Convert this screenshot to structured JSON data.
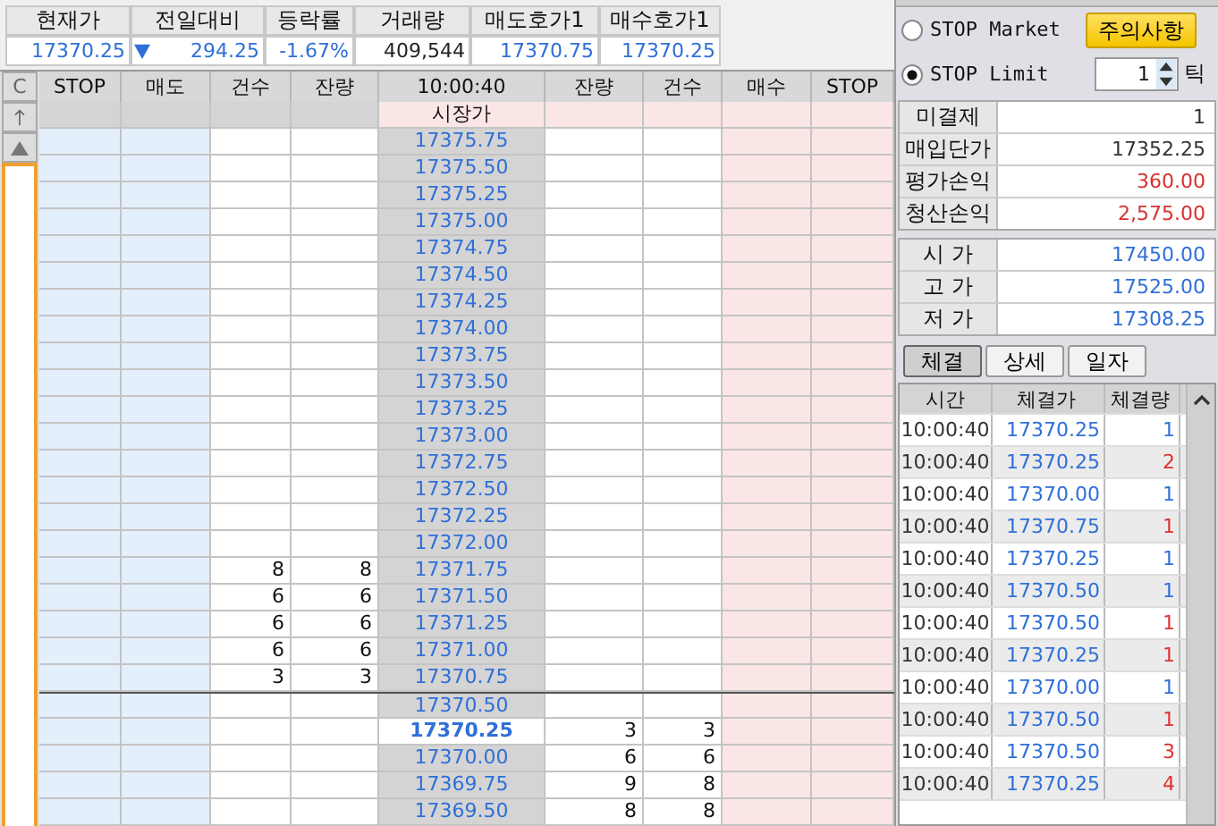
{
  "quote": {
    "columns": [
      "현재가",
      "전일대비",
      "등락률",
      "거래량",
      "매도호가1",
      "매수호가1"
    ],
    "values": [
      "17370.25",
      "294.25",
      "-1.67%",
      "409,544",
      "17370.75",
      "17370.25"
    ]
  },
  "ladder": {
    "clear_button": "C",
    "columns": [
      "STOP",
      "매도",
      "건수",
      "잔량",
      "10:00:40",
      "잔량",
      "건수",
      "매수",
      "STOP"
    ],
    "market_row": "시장가",
    "rows": [
      {
        "price": "17375.75",
        "current": false
      },
      {
        "price": "17375.50",
        "current": false
      },
      {
        "price": "17375.25",
        "current": false
      },
      {
        "price": "17375.00",
        "current": false
      },
      {
        "price": "17374.75",
        "current": false
      },
      {
        "price": "17374.50",
        "current": false
      },
      {
        "price": "17374.25",
        "current": false
      },
      {
        "price": "17374.00",
        "current": false
      },
      {
        "price": "17373.75",
        "current": false
      },
      {
        "price": "17373.50",
        "current": false
      },
      {
        "price": "17373.25",
        "current": false
      },
      {
        "price": "17373.00",
        "current": false
      },
      {
        "price": "17372.75",
        "current": false
      },
      {
        "price": "17372.50",
        "current": false
      },
      {
        "price": "17372.25",
        "current": false
      },
      {
        "price": "17372.00",
        "current": false
      },
      {
        "price": "17371.75",
        "ask_count": "8",
        "ask_qty": "8",
        "current": false
      },
      {
        "price": "17371.50",
        "ask_count": "6",
        "ask_qty": "6",
        "current": false
      },
      {
        "price": "17371.25",
        "ask_count": "6",
        "ask_qty": "6",
        "current": false
      },
      {
        "price": "17371.00",
        "ask_count": "6",
        "ask_qty": "6",
        "current": false
      },
      {
        "price": "17370.75",
        "ask_count": "3",
        "ask_qty": "3",
        "current": false
      },
      {
        "price": "17370.50",
        "current": false
      },
      {
        "price": "17370.25",
        "bid_qty": "3",
        "bid_count": "3",
        "current": true
      },
      {
        "price": "17370.00",
        "bid_qty": "6",
        "bid_count": "6",
        "current": false
      },
      {
        "price": "17369.75",
        "bid_qty": "9",
        "bid_count": "8",
        "current": false
      },
      {
        "price": "17369.50",
        "bid_qty": "8",
        "bid_count": "8",
        "current": false
      }
    ]
  },
  "stop_type": [
    {
      "label": "STOP Market",
      "selected": false
    },
    {
      "label": "STOP Limit",
      "selected": true
    }
  ],
  "notice_button": "주의사항",
  "tick": {
    "value": "1",
    "unit": "틱"
  },
  "position": [
    {
      "label": "미결제",
      "value": "1",
      "kind": "plain"
    },
    {
      "label": "매입단가",
      "value": "17352.25",
      "kind": "plain"
    },
    {
      "label": "평가손익",
      "value": "360.00",
      "kind": "pnl"
    },
    {
      "label": "청산손익",
      "value": "2,575.00",
      "kind": "pnl"
    }
  ],
  "prices": [
    {
      "label": "시 가",
      "value": "17450.00"
    },
    {
      "label": "고 가",
      "value": "17525.00"
    },
    {
      "label": "저 가",
      "value": "17308.25"
    }
  ],
  "tabs": [
    {
      "label": "체결",
      "selected": true
    },
    {
      "label": "상세",
      "selected": false
    },
    {
      "label": "일자",
      "selected": false
    }
  ],
  "trades": {
    "columns": [
      "시간",
      "체결가",
      "체결량"
    ],
    "rows": [
      {
        "time": "10:00:40",
        "price": "17370.25",
        "qty": "1",
        "color": "#2f6fd8"
      },
      {
        "time": "10:00:40",
        "price": "17370.25",
        "qty": "2",
        "color": "#e03030"
      },
      {
        "time": "10:00:40",
        "price": "17370.00",
        "qty": "1",
        "color": "#2f6fd8"
      },
      {
        "time": "10:00:40",
        "price": "17370.75",
        "qty": "1",
        "color": "#e03030"
      },
      {
        "time": "10:00:40",
        "price": "17370.25",
        "qty": "1",
        "color": "#2f6fd8"
      },
      {
        "time": "10:00:40",
        "price": "17370.50",
        "qty": "1",
        "color": "#2f6fd8"
      },
      {
        "time": "10:00:40",
        "price": "17370.50",
        "qty": "1",
        "color": "#e03030"
      },
      {
        "time": "10:00:40",
        "price": "17370.25",
        "qty": "1",
        "color": "#e03030"
      },
      {
        "time": "10:00:40",
        "price": "17370.00",
        "qty": "1",
        "color": "#2f6fd8"
      },
      {
        "time": "10:00:40",
        "price": "17370.50",
        "qty": "1",
        "color": "#e03030"
      },
      {
        "time": "10:00:40",
        "price": "17370.50",
        "qty": "3",
        "color": "#e03030"
      },
      {
        "time": "10:00:40",
        "price": "17370.25",
        "qty": "4",
        "color": "#e03030"
      }
    ]
  }
}
